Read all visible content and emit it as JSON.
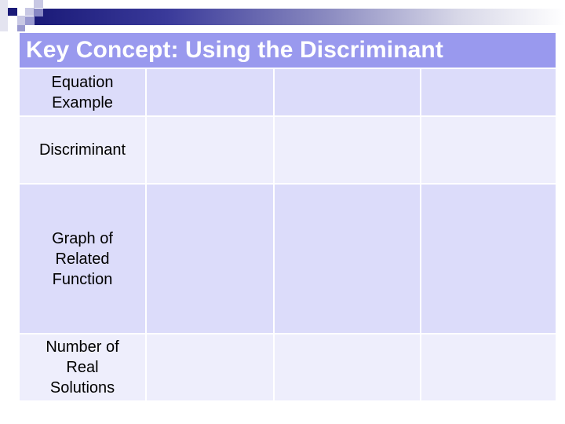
{
  "slide": {
    "title": "Key Concept: Using the Discriminant",
    "colors": {
      "title_bar": "#9999ee",
      "title_text": "#ffffff",
      "row_dark": "#dcdcfa",
      "row_light": "#eeeefc",
      "accent_dark": "#1a1a78"
    }
  },
  "table": {
    "rows": [
      {
        "label": "Equation Example",
        "cells": [
          "",
          "",
          ""
        ]
      },
      {
        "label": "Discriminant",
        "cells": [
          "",
          "",
          ""
        ]
      },
      {
        "label": "Graph of Related Function",
        "cells": [
          "",
          "",
          ""
        ]
      },
      {
        "label": "Number of Real Solutions",
        "cells": [
          "",
          "",
          ""
        ]
      }
    ]
  }
}
